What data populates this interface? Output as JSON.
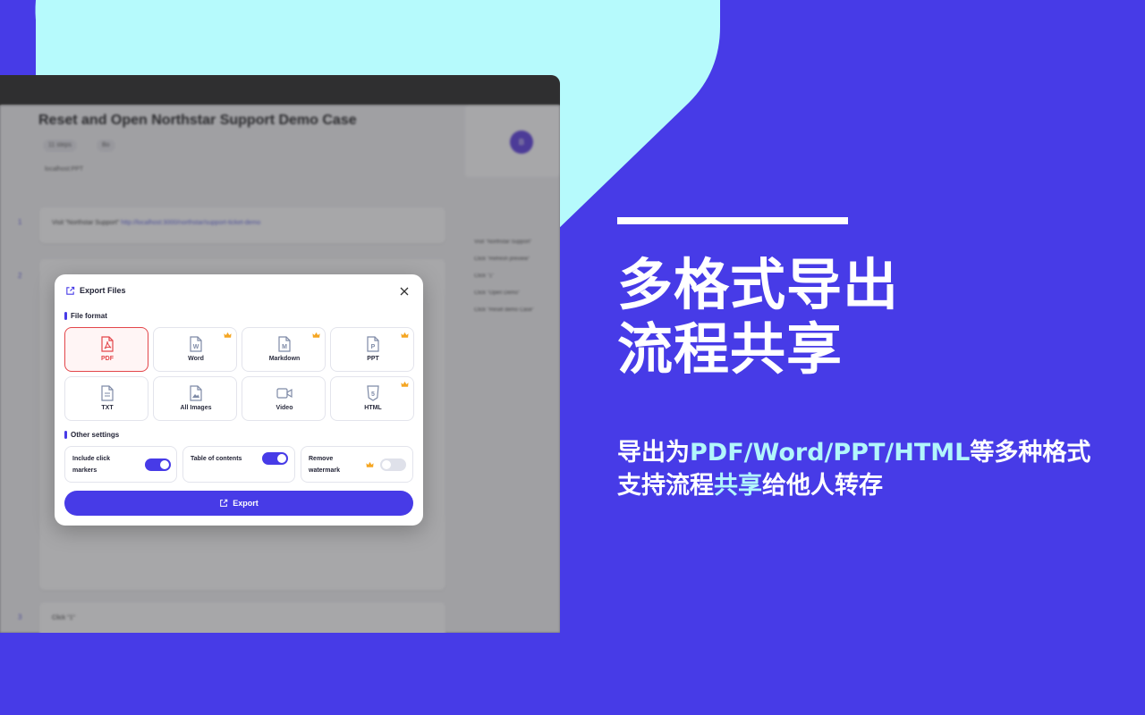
{
  "app": {
    "doc_title": "Reset and Open Northstar Support Demo Case",
    "chip_1": "11 steps",
    "chip_2": "Bo",
    "meta": "localhost:PPT",
    "steps": [
      {
        "num": "1",
        "text": "Visit \"Northstar Support\"",
        "link": "http://localhost:3000/northstar/support-ticket-demo"
      },
      {
        "num": "2",
        "text": ""
      },
      {
        "num": "3",
        "text": "Click \"1\""
      }
    ],
    "toc_items": [
      "Visit \"Northstar Support\"",
      "Click \"Refresh preview\"",
      "Click \"1\"",
      "Click \"Open Demo\"",
      "Click \"Reset demo Case\""
    ],
    "avatar_letter": "B"
  },
  "dialog": {
    "title": "Export Files",
    "file_format_label": "File format",
    "formats": [
      {
        "label": "PDF",
        "icon": "pdf-file-icon",
        "selected": true,
        "premium": false
      },
      {
        "label": "Word",
        "icon": "word-file-icon",
        "selected": false,
        "premium": true
      },
      {
        "label": "Markdown",
        "icon": "markdown-file-icon",
        "selected": false,
        "premium": true
      },
      {
        "label": "PPT",
        "icon": "ppt-file-icon",
        "selected": false,
        "premium": true
      },
      {
        "label": "TXT",
        "icon": "txt-file-icon",
        "selected": false,
        "premium": false
      },
      {
        "label": "All Images",
        "icon": "images-file-icon",
        "selected": false,
        "premium": false
      },
      {
        "label": "Video",
        "icon": "video-icon",
        "selected": false,
        "premium": false
      },
      {
        "label": "HTML",
        "icon": "html5-icon",
        "selected": false,
        "premium": true
      }
    ],
    "other_settings_label": "Other settings",
    "settings": [
      {
        "label_line1": "Include click",
        "label_line2": "markers",
        "on": true
      },
      {
        "label_line1": "Table of contents",
        "label_line2": "",
        "on": true
      },
      {
        "label_line1": "Remove",
        "label_line2": "watermark",
        "on": false,
        "premium": true
      }
    ],
    "export_label": "Export"
  },
  "marketing": {
    "headline_line1": "多格式导出",
    "headline_line2": "流程共享",
    "sub1_pre": "导出为",
    "sub1_hl": "PDF/Word/PPT/HTML",
    "sub1_post": "等多种格式",
    "sub2_pre": "支持流程",
    "sub2_hl": "共享",
    "sub2_post": "给他人转存"
  },
  "colors": {
    "background": "#473BE7",
    "shape": "#B6FAFC",
    "accent": "#473BE7",
    "pdf_red": "#E3464A",
    "premium_gold": "#F5A623"
  }
}
